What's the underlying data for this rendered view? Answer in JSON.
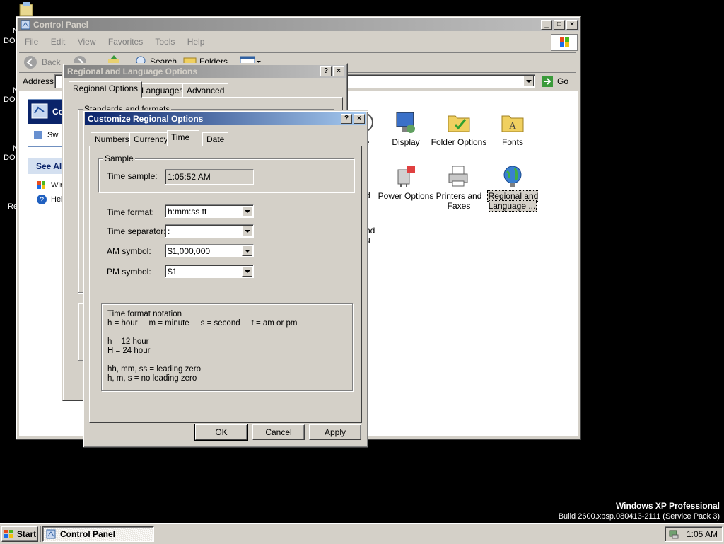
{
  "desktop": {
    "watermark_line1": "Windows XP Professional",
    "watermark_line2": "Build 2600.xpsp.080413-2111 (Service Pack 3)",
    "left_fragments": [
      "N",
      "DO",
      "N",
      "DO",
      "N",
      "DO",
      "Re"
    ]
  },
  "control_panel": {
    "title": "Control Panel",
    "menu": [
      "File",
      "Edit",
      "View",
      "Favorites",
      "Tools",
      "Help"
    ],
    "toolbar": {
      "back": "Back",
      "search": "Search",
      "folders": "Folders"
    },
    "address_label": "Address",
    "go_label": "Go",
    "side_fragment_1": "Co",
    "side_fragment_2": "Sw",
    "see_also": "See Als",
    "see_also_items": [
      "Wir",
      "Hel"
    ],
    "icons": [
      {
        "label": "me",
        "icon": "date-time-icon"
      },
      {
        "label": "Display",
        "icon": "display-icon"
      },
      {
        "label": "Folder Options",
        "icon": "folder-options-icon"
      },
      {
        "label": "Fonts",
        "icon": "fonts-icon"
      },
      {
        "label": "d",
        "icon": "partial-icon"
      },
      {
        "label": "Power Options",
        "icon": "power-options-icon"
      },
      {
        "label": "Printers and Faxes",
        "icon": "printers-icon"
      },
      {
        "label": "Regional and Language ...",
        "icon": "globe-icon"
      }
    ],
    "partial_labels": [
      "nd",
      "u"
    ]
  },
  "regional_dialog": {
    "title": "Regional and Language Options",
    "tabs": [
      "Regional Options",
      "Languages",
      "Advanced"
    ],
    "group_label": "Standards and formats"
  },
  "customize_dialog": {
    "title": "Customize Regional Options",
    "tabs": [
      "Numbers",
      "Currency",
      "Time",
      "Date"
    ],
    "selected_tab": "Time",
    "sample_group": "Sample",
    "time_sample_label": "Time sample:",
    "time_sample_value": "1:05:52 AM",
    "time_format_label": "Time format:",
    "time_format_value": "h:mm:ss tt",
    "time_separator_label": "Time separator:",
    "time_separator_value": ":",
    "am_symbol_label": "AM symbol:",
    "am_symbol_value": "$1,000,000",
    "pm_symbol_label": "PM symbol:",
    "pm_symbol_value": "$1",
    "notation": {
      "title": "Time format notation",
      "line1": "h = hour     m = minute     s = second     t = am or pm",
      "line2": "h = 12 hour",
      "line3": "H = 24 hour",
      "line4": "hh, mm, ss = leading zero",
      "line5": "h, m, s = no leading zero"
    },
    "buttons": {
      "ok": "OK",
      "cancel": "Cancel",
      "apply": "Apply"
    }
  },
  "taskbar": {
    "start": "Start",
    "task": "Control Panel",
    "clock": "1:05 AM"
  }
}
